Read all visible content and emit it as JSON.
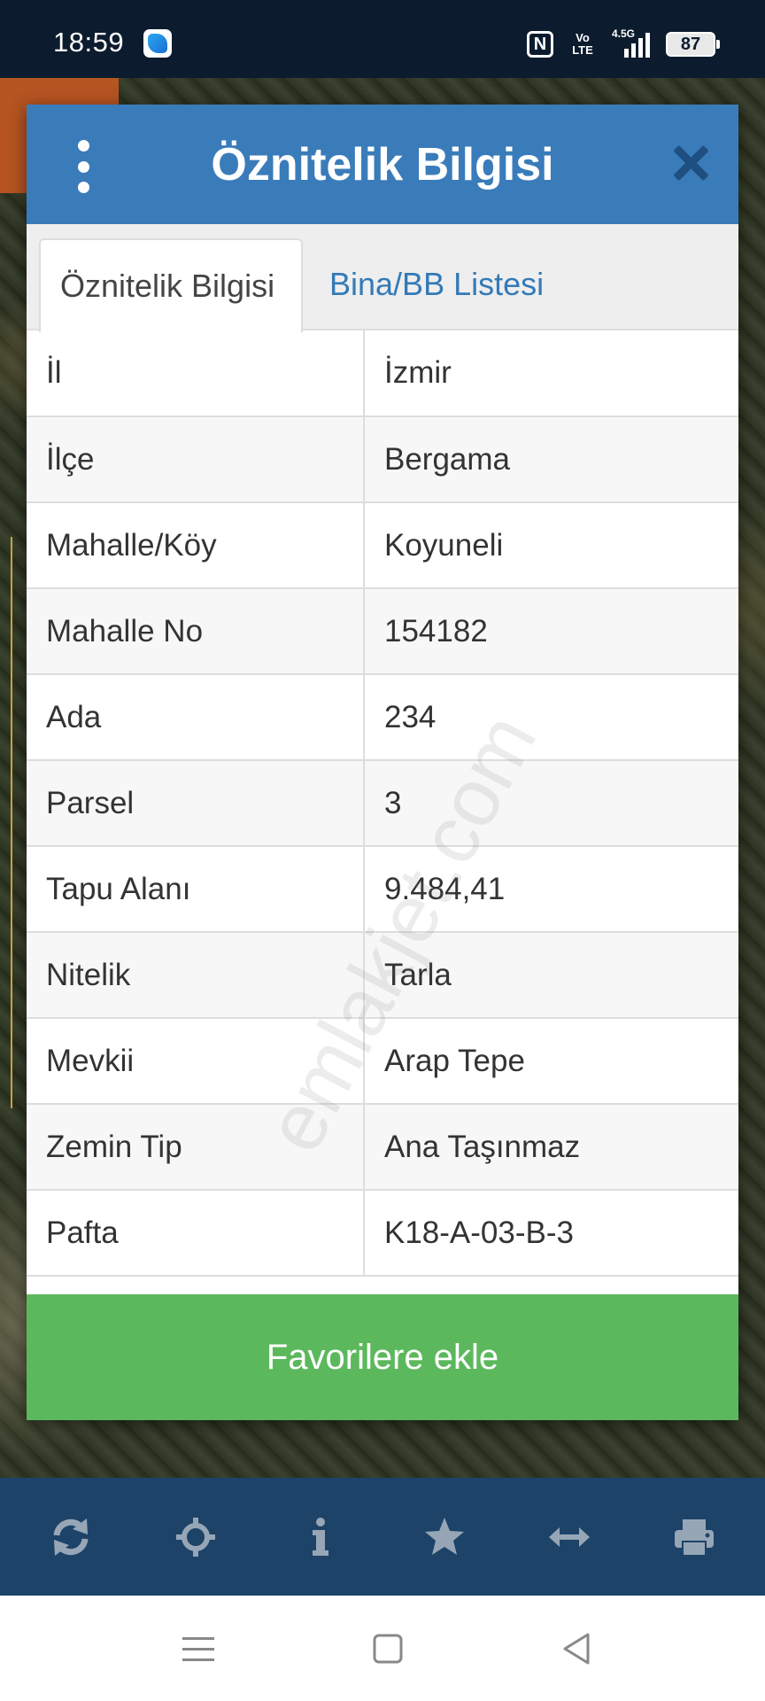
{
  "status_bar": {
    "time": "18:59",
    "volte_line1": "Vo",
    "volte_line2": "LTE",
    "network": "4.5G",
    "battery": "87"
  },
  "dialog": {
    "title": "Öznitelik Bilgisi",
    "tabs": [
      {
        "label": "Öznitelik Bilgisi",
        "active": true
      },
      {
        "label": "Bina/BB Listesi",
        "active": false
      }
    ],
    "rows": [
      {
        "key": "İl",
        "value": "İzmir"
      },
      {
        "key": "İlçe",
        "value": "Bergama"
      },
      {
        "key": "Mahalle/Köy",
        "value": "Koyuneli"
      },
      {
        "key": "Mahalle No",
        "value": "154182"
      },
      {
        "key": "Ada",
        "value": "234"
      },
      {
        "key": "Parsel",
        "value": "3"
      },
      {
        "key": "Tapu Alanı",
        "value": "9.484,41"
      },
      {
        "key": "Nitelik",
        "value": "Tarla"
      },
      {
        "key": "Mevkii",
        "value": "Arap Tepe"
      },
      {
        "key": "Zemin Tip",
        "value": "Ana Taşınmaz"
      },
      {
        "key": "Pafta",
        "value": "K18-A-03-B-3"
      }
    ],
    "favorite_label": "Favorilere ekle"
  },
  "watermark": "emlakjet.com",
  "toolbar": {
    "icons": [
      "refresh-icon",
      "crosshair-icon",
      "info-icon",
      "star-icon",
      "measure-arrows-icon",
      "print-icon"
    ],
    "icon_color": "#97a6b6"
  },
  "colors": {
    "header": "#3a7cba",
    "tab_link": "#337ab7",
    "favorite_button": "#5cb85c",
    "toolbar": "#1d4368"
  }
}
